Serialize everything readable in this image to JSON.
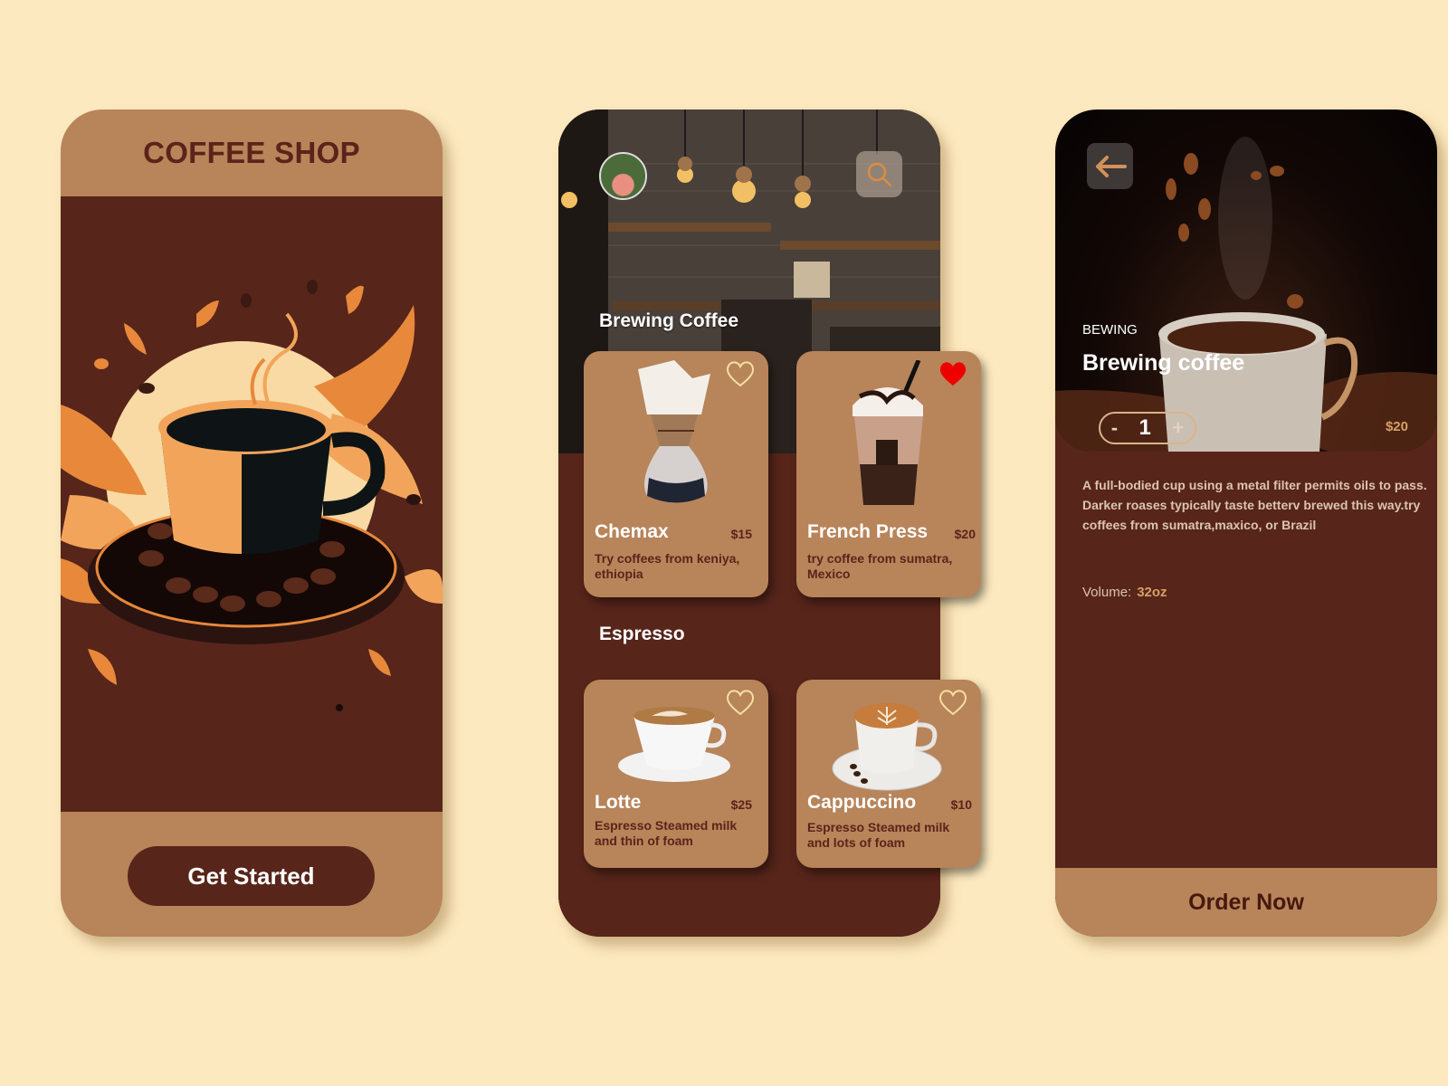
{
  "colors": {
    "background": "#fde9bf",
    "primary_dark": "#57251a",
    "primary_light": "#b8845a",
    "accent_price": "#d4a064",
    "favorite_active": "#ee0000",
    "favorite_outline": "#f5dfa0"
  },
  "welcome_screen": {
    "title": "COFFEE SHOP",
    "illustration": "coffee-cup-illustration",
    "cta_label": "Get Started"
  },
  "menu_screen": {
    "hero_title": "Brewing Coffee",
    "avatar": "user-avatar",
    "search_icon": "search-icon",
    "brewing_items": [
      {
        "name": "Chemax",
        "price": "$15",
        "description": "Try coffees from keniya, ethiopia",
        "favorite": false,
        "image": "chemex-brewer"
      },
      {
        "name": "French Press",
        "price": "$20",
        "description": "try  coffee from sumatra, Mexico",
        "favorite": true,
        "image": "iced-mocha-cup"
      }
    ],
    "section_title": "Espresso",
    "espresso_items": [
      {
        "name": "Lotte",
        "price": "$25",
        "description": "Espresso Steamed milk and thin of foam",
        "favorite": false,
        "image": "latte-cup"
      },
      {
        "name": "Cappuccino",
        "price": "$10",
        "description": "Espresso Steamed milk and lots of foam",
        "favorite": false,
        "image": "cappuccino-cup"
      }
    ]
  },
  "detail_screen": {
    "back_icon": "arrow-left-icon",
    "category": "BEWING",
    "title": "Brewing coffee",
    "quantity": {
      "minus": "-",
      "value": "1",
      "plus": "+"
    },
    "price": "$20",
    "description": "A full-bodied cup using a metal filter permits oils to pass. Darker roases typically taste betterv brewed this way.try coffees from sumatra,maxico, or Brazil",
    "volume_label": "Volume:",
    "volume_value": "32oz",
    "order_label": "Order Now"
  }
}
